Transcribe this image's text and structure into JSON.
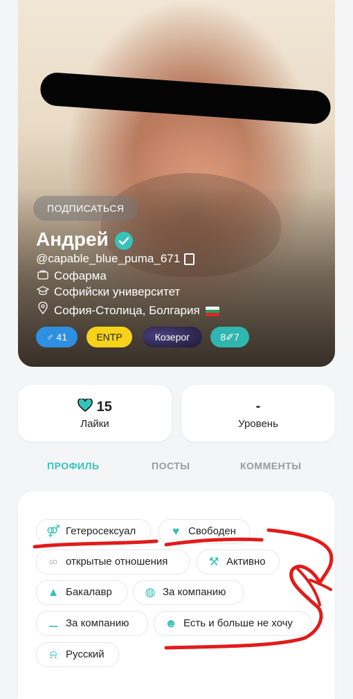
{
  "profile": {
    "follow_label": "ПОДПИСАТЬСЯ",
    "name": "Андрей",
    "username": "@capable_blue_puma_671",
    "work": "Софарма",
    "education": "Софийски университет",
    "location": "София-Столица, Болгария",
    "flag": "🇧🇬",
    "chips": {
      "gender": "♂ 41",
      "mbti": "ENTP",
      "zodiac": "Козерог",
      "number": "8✐7"
    }
  },
  "stats": {
    "likes_value": "15",
    "likes_label": "Лайки",
    "level_value": "-",
    "level_label": "Уровень"
  },
  "tabs": [
    "ПРОФИЛЬ",
    "ПОСТЫ",
    "КОММЕНТЫ"
  ],
  "tags": [
    "Гетеросексуал",
    "Свободен",
    "открытые отношения",
    "Активно",
    "Бакалавр",
    "За компанию",
    "За компанию",
    "Есть и больше не хочу",
    "Русский"
  ],
  "colors": {
    "accent": "#37c2b9",
    "annotation_red": "#e21b1b",
    "mbti_yellow": "#f6d21b",
    "gender_blue": "#2f8fe0"
  }
}
